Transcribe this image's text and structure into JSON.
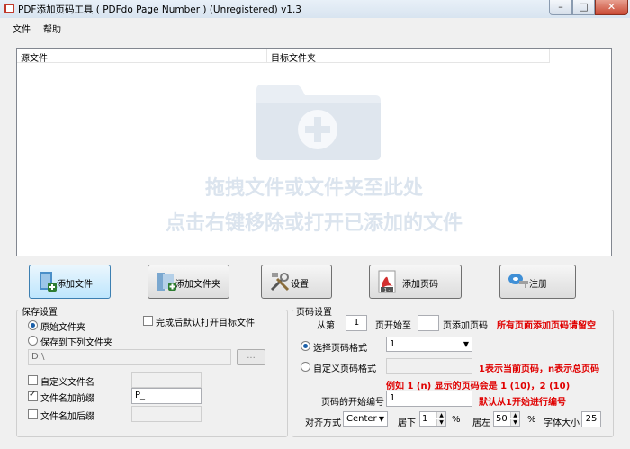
{
  "window": {
    "title": "PDF添加页码工具 ( PDFdo Page Number ) (Unregistered) v1.3",
    "minimize": "–",
    "maximize": "□",
    "close": "✕"
  },
  "menu": {
    "file": "文件",
    "help": "帮助"
  },
  "filelist": {
    "columns": [
      "源文件",
      "目标文件夹"
    ],
    "drop_hint_line1": "拖拽文件或文件夹至此处",
    "drop_hint_line2": "点击右键移除或打开已添加的文件"
  },
  "buttons": {
    "add_file": "添加文件",
    "add_folder": "添加文件夹",
    "settings": "设置",
    "add_page_number": "添加页码",
    "register": "注册"
  },
  "save_settings": {
    "legend": "保存设置",
    "original_folder": "原始文件夹",
    "save_to_folder": "保存到下列文件夹",
    "open_after": "完成后默认打开目标文件",
    "folder_path": "D:\\",
    "browse": "...",
    "custom_filename": "自定义文件名",
    "custom_filename_value": "",
    "prefix": "文件名加前缀",
    "prefix_value": "P_",
    "suffix": "文件名加后缀",
    "suffix_value": ""
  },
  "page_settings": {
    "legend": "页码设置",
    "from_page": "从第",
    "from_value": "1",
    "start_to": "页开始至",
    "to_value": "",
    "add_text": "页添加页码",
    "note_all": "所有页面添加页码请留空",
    "select_format": "选择页码格式",
    "format_value": "1",
    "custom_format": "自定义页码格式",
    "custom_format_value": "",
    "note_format1": "1表示当前页码，n表示总页码",
    "note_format2": "例如 1 (n) 显示的页码会是 1 (10)，2 (10)",
    "start_number": "页码的开始编号",
    "start_number_value": "1",
    "note_start": "默认从1开始进行编号",
    "align": "对齐方式",
    "align_value": "Center",
    "bottom": "居下",
    "bottom_value": "1",
    "percent1": "%",
    "left": "居左",
    "left_value": "50",
    "percent2": "%",
    "font_size": "字体大小",
    "font_size_value": "25"
  }
}
